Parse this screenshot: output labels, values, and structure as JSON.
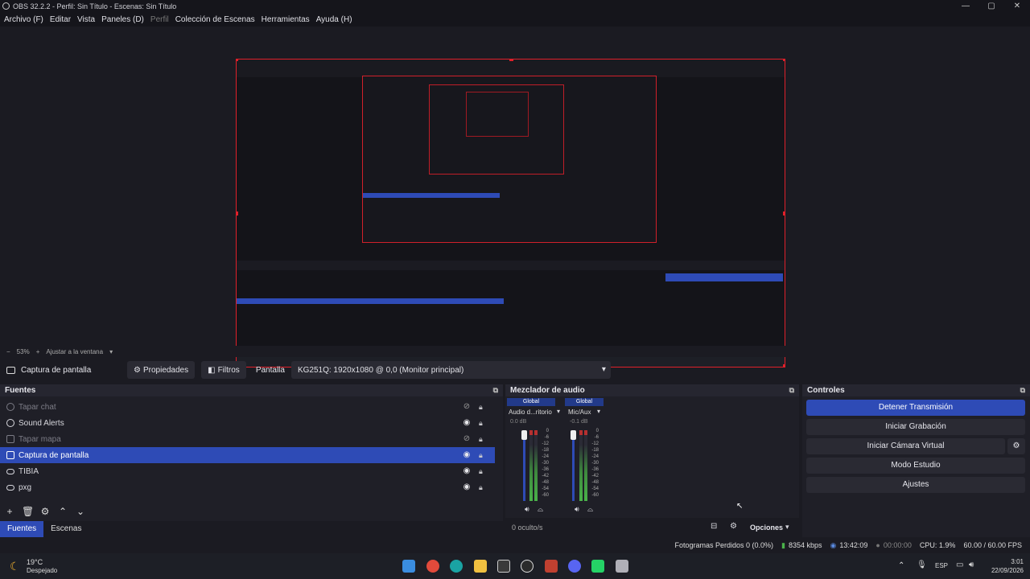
{
  "window": {
    "title": "OBS 32.2.2 - Perfil: Sin Título - Escenas: Sin Título",
    "minimize": "—",
    "maximize": "▢",
    "close": "✕"
  },
  "menu": {
    "items": [
      "Archivo (F)",
      "Editar",
      "Vista",
      "Paneles (D)",
      "Perfil",
      "Colección de Escenas",
      "Herramientas",
      "Ayuda (H)"
    ]
  },
  "zoom": {
    "minus": "−",
    "level": "53%",
    "plus": "+",
    "fit": "Ajustar a la ventana"
  },
  "propbar": {
    "source_name": "Captura de pantalla",
    "properties": "Propiedades",
    "filters": "Filtros",
    "display_label": "Pantalla",
    "display_value": "KG251Q: 1920x1080 @ 0,0 (Monitor principal)"
  },
  "sources": {
    "title": "Fuentes",
    "items": [
      {
        "name": "Tapar chat",
        "hidden": true
      },
      {
        "name": "Sound Alerts",
        "hidden": false
      },
      {
        "name": "Tapar mapa",
        "hidden": true
      },
      {
        "name": "Captura de pantalla",
        "hidden": false,
        "selected": true
      },
      {
        "name": "TIBIA",
        "hidden": false
      },
      {
        "name": "pxg",
        "hidden": false
      }
    ],
    "tabs": [
      "Fuentes",
      "Escenas"
    ]
  },
  "mixer": {
    "title": "Mezclador de audio",
    "channels": [
      {
        "badge": "Global",
        "name": "Audio d...ritorio",
        "db": "0.0 dB"
      },
      {
        "badge": "Global",
        "name": "Mic/Aux",
        "db": "-0.1 dB"
      }
    ],
    "scale": [
      "0",
      "-6",
      "-12",
      "-18",
      "-24",
      "-30",
      "-36",
      "-42",
      "-48",
      "-54",
      "-60"
    ],
    "hidden": "0 oculto/s",
    "options": "Opciones"
  },
  "controls": {
    "title": "Controles",
    "buttons": [
      "Detener Transmisión",
      "Iniciar Grabación",
      "Iniciar Cámara Virtual",
      "Modo Estudio",
      "Ajustes"
    ]
  },
  "status": {
    "dropped": "Fotogramas Perdidos 0 (0.0%)",
    "bitrate": "8354 kbps",
    "stream_time": "13:42:09",
    "rec_time": "00:00:00",
    "cpu": "CPU: 1.9%",
    "fps": "60.00 / 60.00 FPS"
  },
  "taskbar": {
    "weather_temp": "19°C",
    "weather_desc": "Despejado",
    "lang": "ESP",
    "time": "3:01",
    "date": "22/09/2026"
  },
  "colors": {
    "accent": "#2e4bb6",
    "preview_border": "#e0202a",
    "background": "#1b1b22"
  }
}
